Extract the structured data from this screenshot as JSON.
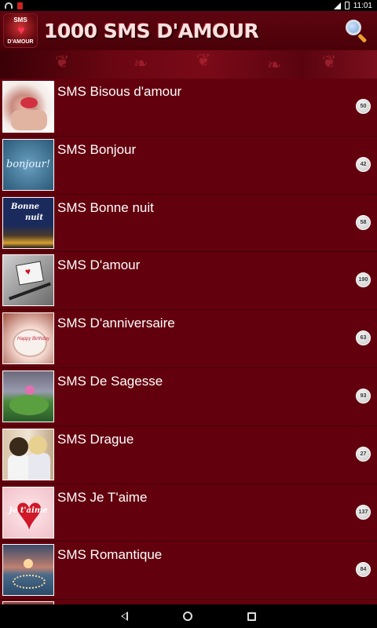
{
  "status_bar": {
    "time": "11:01"
  },
  "header": {
    "logo_top": "SMS",
    "logo_bottom": "D'AMOUR",
    "title": "1000 SMS D'AMOUR",
    "search_icon": "search-icon"
  },
  "categories": [
    {
      "title": "SMS Bisous d'amour",
      "count": "50"
    },
    {
      "title": "SMS Bonjour",
      "count": "42"
    },
    {
      "title": "SMS Bonne nuit",
      "count": "58"
    },
    {
      "title": "SMS D'amour",
      "count": "190"
    },
    {
      "title": "SMS D'anniversaire",
      "count": "63"
    },
    {
      "title": "SMS De Sagesse",
      "count": "93"
    },
    {
      "title": "SMS Drague",
      "count": "27"
    },
    {
      "title": "SMS Je T'aime",
      "count": "137"
    },
    {
      "title": "SMS Romantique",
      "count": "84"
    }
  ],
  "thumbnails": {
    "bonjour_text": "bonjour!",
    "bonne_nuit_line1": "Bonne",
    "bonne_nuit_line2": "nuit",
    "anniversaire_text": "Happy Birthday",
    "jetaime_text": "Je t'aime"
  },
  "colors": {
    "header_bg": "#4a0008",
    "list_bg": "#63000d",
    "row_text": "#ffffff",
    "badge_bg": "#dcdcdc"
  }
}
